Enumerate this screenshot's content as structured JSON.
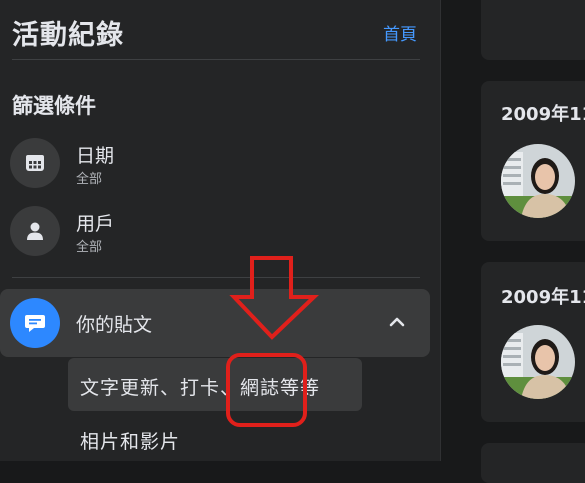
{
  "header": {
    "title": "活動紀錄",
    "home_link": "首頁"
  },
  "filters": {
    "section_title": "篩選條件",
    "items": [
      {
        "label": "日期",
        "sub": "全部",
        "icon": "calendar-icon"
      },
      {
        "label": "用戶",
        "sub": "全部",
        "icon": "person-icon"
      }
    ]
  },
  "posts": {
    "label": "你的貼文",
    "icon": "message-icon",
    "expanded": true,
    "subitems": [
      {
        "label": "文字更新、打卡、網誌等等",
        "selected": true
      },
      {
        "label": "相片和影片",
        "selected": false
      }
    ]
  },
  "feed": {
    "cards": [
      {
        "date": "2009年11"
      },
      {
        "date": "2009年11"
      }
    ]
  },
  "annotation": {
    "color": "#e0201b"
  },
  "colors": {
    "accent": "#2d88ff",
    "link": "#4599ff",
    "sidebar_bg": "#242526",
    "page_bg": "#18191a"
  }
}
